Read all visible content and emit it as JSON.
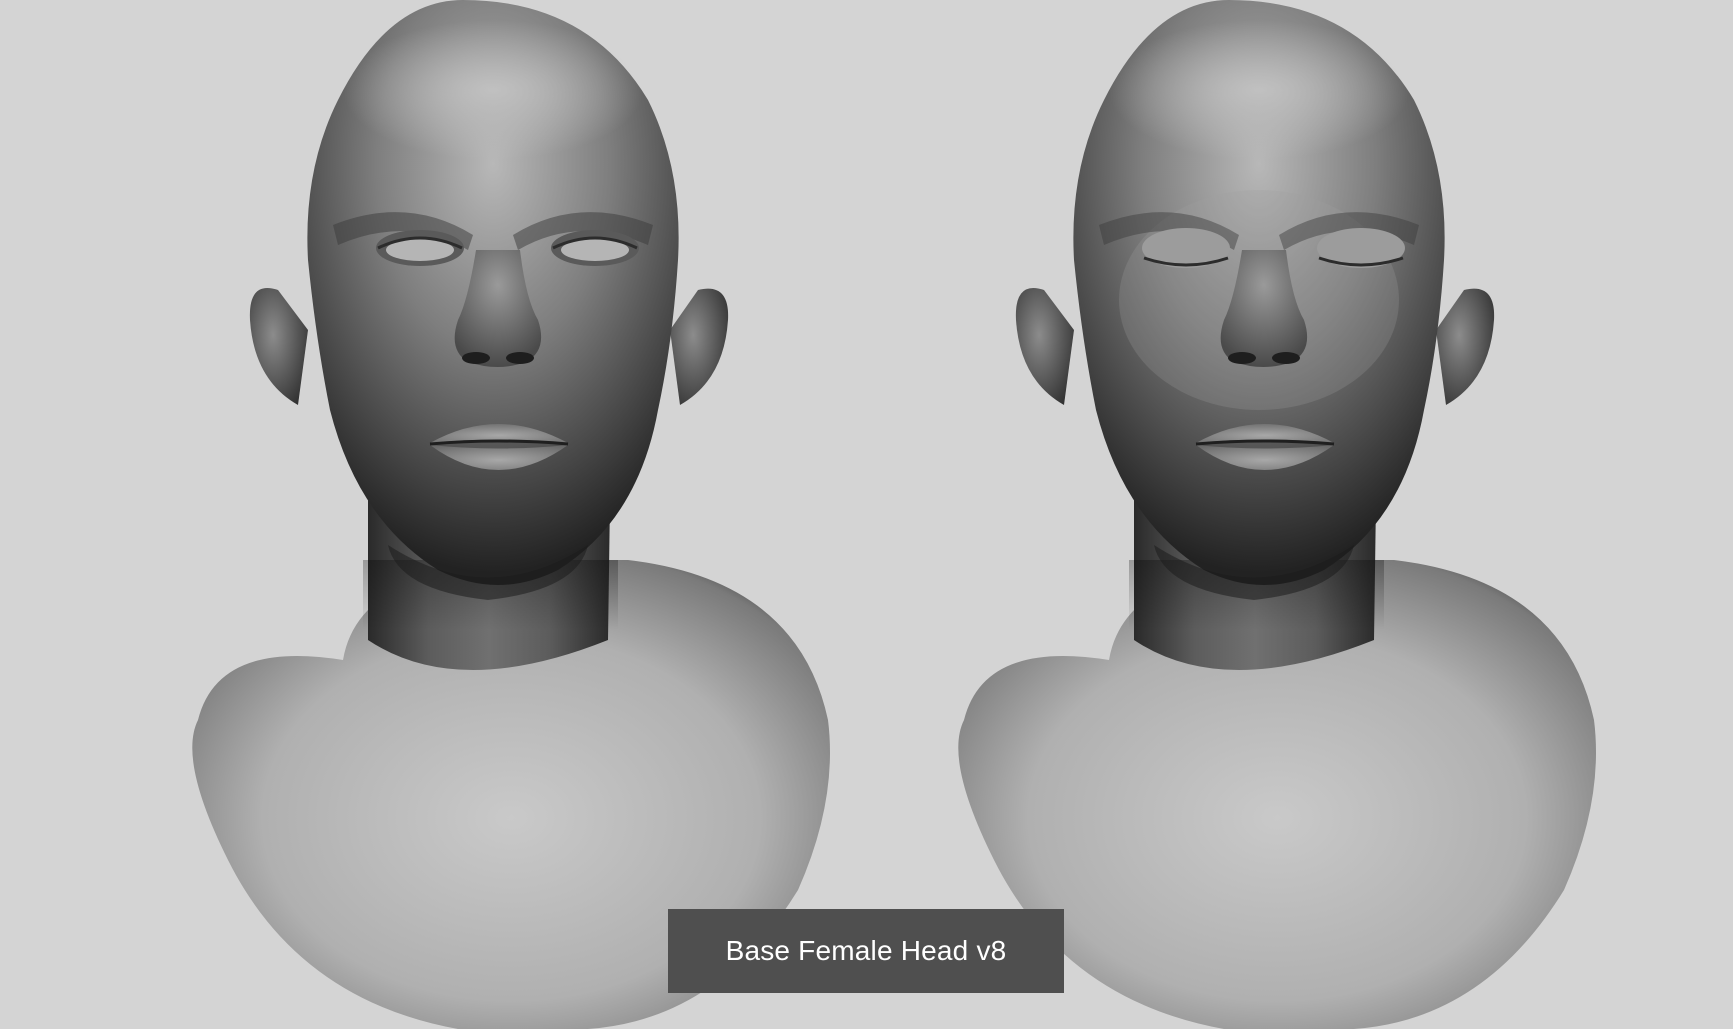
{
  "caption": "Base Female Head v8",
  "colors": {
    "background": "#d4d4d4",
    "caption_background": "#4f4f4f",
    "caption_text": "#ffffff"
  },
  "views": [
    {
      "name": "head-eyes-open",
      "eyes": "open"
    },
    {
      "name": "head-eyes-closed",
      "eyes": "closed"
    }
  ]
}
